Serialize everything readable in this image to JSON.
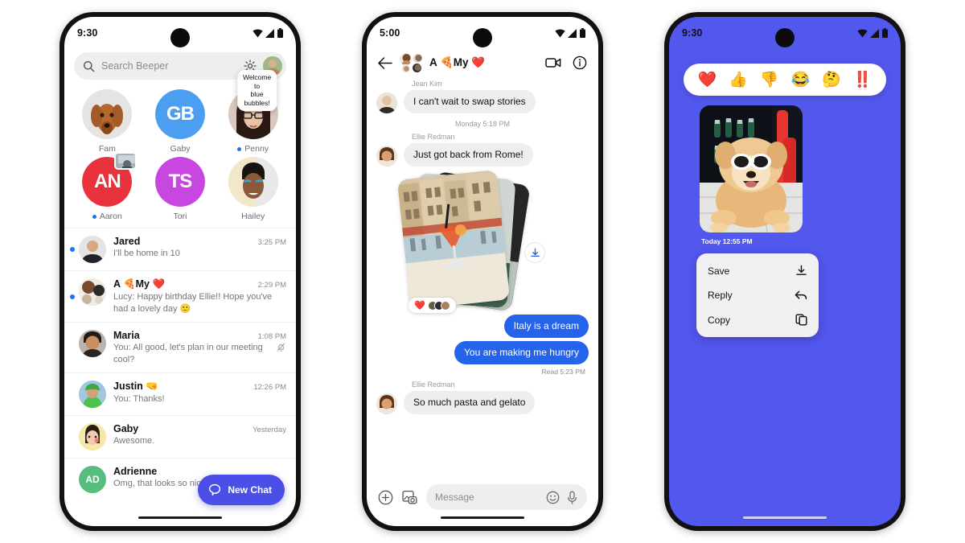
{
  "phone1": {
    "status": {
      "time": "9:30",
      "icons": [
        "wifi-icon",
        "signal-icon",
        "battery-icon"
      ]
    },
    "search": {
      "placeholder": "Search Beeper",
      "search_icon": "search-icon",
      "settings_icon": "gear-icon",
      "avatar": "profile-avatar"
    },
    "favorites": [
      {
        "name": "Fam",
        "type": "photo",
        "unread": false,
        "tooltip": null
      },
      {
        "name": "Gaby",
        "type": "monogram",
        "initials": "GB",
        "color": "#4c9ef0",
        "unread": false,
        "tooltip": null
      },
      {
        "name": "Penny",
        "type": "photo",
        "unread": true,
        "tooltip": "Welcome to\nblue bubbles!"
      },
      {
        "name": "Aaron",
        "type": "monogram",
        "initials": "AN",
        "color": "#e8333c",
        "unread": true,
        "badge": true,
        "tooltip": null
      },
      {
        "name": "Tori",
        "type": "monogram",
        "initials": "TS",
        "color": "#c847e0",
        "unread": false,
        "tooltip": null
      },
      {
        "name": "Hailey",
        "type": "photo",
        "unread": false,
        "tooltip": null
      }
    ],
    "chats": [
      {
        "name": "Jared",
        "preview": "I'll be home in 10",
        "time": "3:25 PM",
        "unread": true,
        "muted": false,
        "avatar_type": "photo"
      },
      {
        "name": "A 🍕My ❤️",
        "preview": "Lucy: Happy birthday Ellie!! Hope you've had a lovely day  🙂",
        "time": "2:29 PM",
        "unread": true,
        "muted": false,
        "avatar_type": "cluster"
      },
      {
        "name": "Maria",
        "preview": "You: All good, let's plan in our meeting cool?",
        "time": "1:08 PM",
        "unread": false,
        "muted": true,
        "avatar_type": "photo"
      },
      {
        "name": "Justin 🤜",
        "preview": "You: Thanks!",
        "time": "12:26 PM",
        "unread": false,
        "muted": false,
        "avatar_type": "photo"
      },
      {
        "name": "Gaby",
        "preview": "Awesome.",
        "time": "Yesterday",
        "unread": false,
        "muted": false,
        "avatar_type": "photo"
      },
      {
        "name": "Adrienne",
        "preview": "Omg, that looks so nice!",
        "time": "",
        "unread": false,
        "muted": false,
        "avatar_type": "initials",
        "initials": "AD",
        "avatar_color": "#56bd7f"
      }
    ],
    "fab": {
      "label": "New Chat",
      "icon": "chat-bubble-icon",
      "color": "#4b4fe8"
    }
  },
  "phone2": {
    "status": {
      "time": "5:00"
    },
    "header": {
      "back_icon": "back-arrow-icon",
      "title": "A 🍕My ❤️",
      "video_icon": "video-camera-icon",
      "info_icon": "info-icon"
    },
    "messages": [
      {
        "kind": "incoming",
        "sender": "Jean Kim",
        "text": "I can't wait to swap stories"
      },
      {
        "kind": "divider",
        "text": "Monday 5:18 PM"
      },
      {
        "kind": "incoming",
        "sender": "Ellie Redman",
        "text": "Just got back from Rome!"
      },
      {
        "kind": "photo-stack",
        "reaction": "❤️",
        "download_icon": "download-icon"
      },
      {
        "kind": "outgoing",
        "text": "Italy is a dream"
      },
      {
        "kind": "outgoing",
        "text": "You are making me hungry"
      },
      {
        "kind": "receipt",
        "text": "Read  5:23 PM"
      },
      {
        "kind": "incoming",
        "sender": "Ellie Redman",
        "text": "So much pasta and gelato"
      }
    ],
    "composer": {
      "plus_icon": "plus-circle-icon",
      "gallery_icon": "gallery-camera-icon",
      "placeholder": "Message",
      "emoji_icon": "emoji-icon",
      "mic_icon": "microphone-icon"
    },
    "bubble_color": "#2563eb"
  },
  "phone3": {
    "status": {
      "time": "9:30"
    },
    "background_color": "#5257ee",
    "reactions": [
      "❤️",
      "👍",
      "👎",
      "😂",
      "🤔",
      "‼️"
    ],
    "photo_caption": "Today  12:55 PM",
    "menu": [
      {
        "label": "Save",
        "icon": "download-icon"
      },
      {
        "label": "Reply",
        "icon": "reply-arrow-icon"
      },
      {
        "label": "Copy",
        "icon": "copy-icon"
      }
    ]
  }
}
